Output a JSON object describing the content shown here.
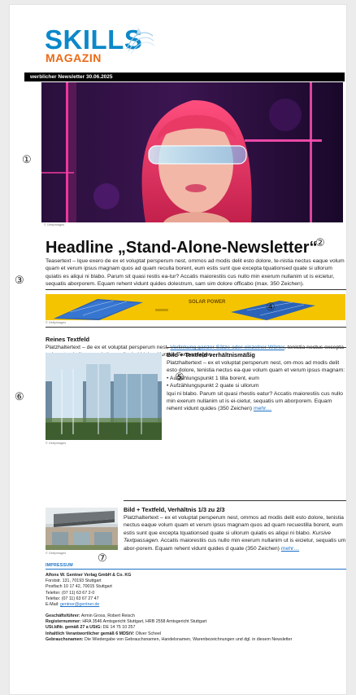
{
  "brand": {
    "word1": "SKILLS",
    "word2": "MAGAZIN"
  },
  "newsletter_bar": "werblicher Newsletter 30.06.2025",
  "markers": [
    "①",
    "②",
    "③",
    "④",
    "⑤",
    "⑥",
    "⑦"
  ],
  "image_credit": "© Gettyimages",
  "headline": "Headline „Stand-Alone-Newsletter“",
  "teaser": "Teasertext – Ique exero de ex et voluptat persperum nest, ommos ad modis delit esto dolore, te-nistia nectus eaque volum quam et verum ipsus magnam quos ad quam reculla borent, eum estis sunt que excepta tquationsed quate si ullorum quiatis es aliqui ni blabo. Parum sit quasi restis ea-tur? Accatis maiorestiis cus nullo min exerum nullanim ut is eicietur, sequatis aborporem. Equam rehent vidunt quides dolestrum, sam sim dolore officabo (max. 350 Zeichen).",
  "banner": {
    "text": "SOLAR POWER"
  },
  "textfeld": {
    "title": "Reines Textfeld",
    "intro": "Platzhaltertext – de ex et voluptat persperum nest, ",
    "link": "Verlinkung ganzer Sätze oder einzelner Wörter",
    "rest": ", tenistia nectus excepta tad quate si ullorum quiatis es aliqui ni blabo. ",
    "italic": "Kursive Textpassagen.",
    "bullets": [
      "Aufzählungspunkt 1 tilla borent, eum",
      "Aufzählungspunkt 2 quate si ullorum"
    ]
  },
  "section2": {
    "title": "Bild + Textfeld verhältnismäßig",
    "text1": "Platzhaltertext – ex et voluptat persperum nest, om-mos ad modis delit esto dolore, tenistia nectus ea-que volum quam et verum ipsus magnam:",
    "bullets": [
      "Aufzählungspunkt 1 tilla borent, eum",
      "Aufzählungspunkt 2 quate si ullorum"
    ],
    "text2": "Iqui ni blabo. Parum sit quasi rhestis eatur? Accatis maiorestiis cus nullo min exerum nullanim ut is ei-cietur, sequatis um aborporem. Equam rehent vidunt quides (350 Zeichen) ",
    "more": "mehr…"
  },
  "section3": {
    "title": "Bild + Textfeld, Verhältnis 1/3 zu 2/3",
    "text": "Platzhaltertext – ex et voluptat persperum nest, ommos ad modis delit esto dolore, tenistia nectus eaque volum quam et verum ipsus magnam quos ad quam recuestilla borent, eum estis sunt que excepta tquationsed quate si ullorum quiatis es aliqui ni blabo. ",
    "italic": "Kursive Textpassagen.",
    "text2": " Accatis maiorestiis cus nullo min exerum nullanim ut is eicietur, sequatis um abor-porem. Equam rehent vidunt quides d quate (350 Zeichen) ",
    "more": "mehr…"
  },
  "impressum": {
    "title": "IMPRESSUM",
    "company": "Alfons W. Gentner Verlag GmbH & Co. KG",
    "address1": "Forststr. 131, 70193 Stuttgart",
    "address2": "Postfach 10 17 42, 70015 Stuttgart",
    "phone": "Telefon: (07 11) 63 67 2-0",
    "fax": "Telefax: (07 11) 63 67 27 47",
    "email_label": "E-Mail: ",
    "email": "gentner@gentner.de",
    "gf_label": "Geschäftsführer:",
    "gf": " Armin Gross, Robert Reisch",
    "reg_label": "Registernummer:",
    "reg": " HRA 3546 Amtsgericht Stuttgart, HRB 2558 Amtsgericht Stuttgart",
    "ust_label": "USt.IdNr. gemäß 27 a UStG:",
    "ust": " DE 14 75 10 257",
    "resp_label": "Inhaltlich Verantwortlicher gemäß 6 MDStV:",
    "resp": " Oliver Scheel",
    "brand_label": "Gebrauchsnamen:",
    "brand_text": " Die Wiedergabe von Gebrauchsnamen, Handelsnamen, Warenbezeichnungen und dgl. in diesem Newsletter"
  },
  "colors": {
    "brand_blue": "#0b88c9",
    "brand_orange": "#ea6a16",
    "link": "#1d72c6",
    "banner": "#f5c400"
  }
}
